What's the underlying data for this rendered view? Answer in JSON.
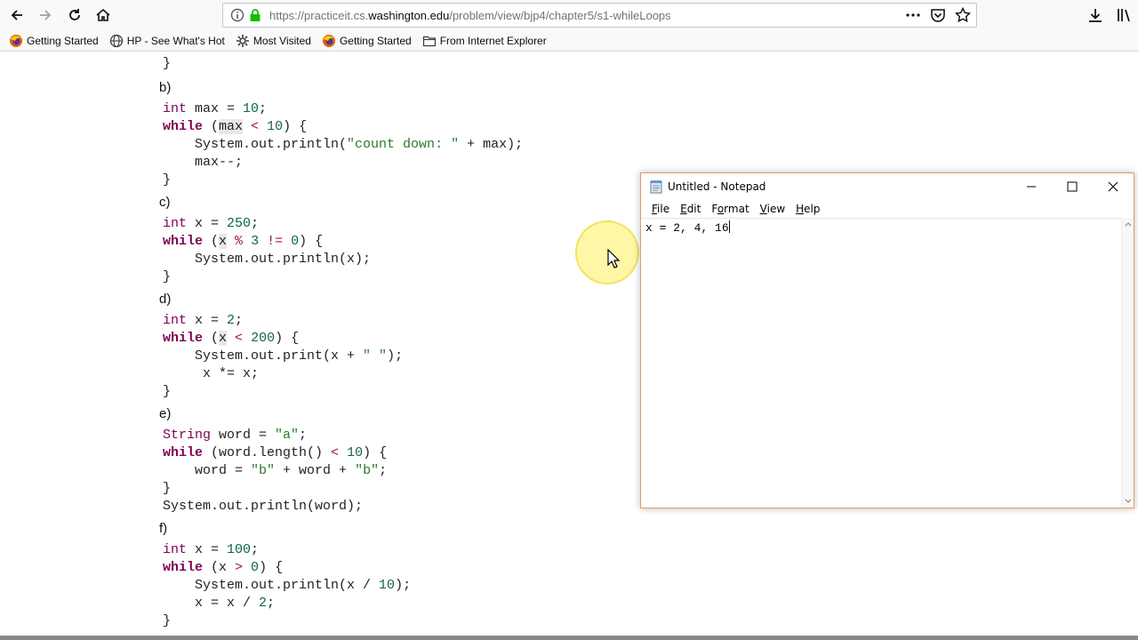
{
  "browser": {
    "url_prefix": "https://practiceit.cs.",
    "url_host": "washington.edu",
    "url_path": "/problem/view/bjp4/chapter5/s1-whileLoops",
    "bookmarks": [
      {
        "label": "Getting Started",
        "icon": "firefox-icon"
      },
      {
        "label": "HP - See What's Hot",
        "icon": "globe-icon"
      },
      {
        "label": "Most Visited",
        "icon": "gear-icon"
      },
      {
        "label": "Getting Started",
        "icon": "firefox-icon"
      },
      {
        "label": "From Internet Explorer",
        "icon": "folder-icon"
      }
    ]
  },
  "code": {
    "top_brace": "}",
    "b": {
      "label": "b)",
      "l1_type": "int",
      "l1_rest": " max = ",
      "l1_num": "10",
      "l1_end": ";",
      "l2_kw": "while",
      "l2_open": " (",
      "l2_var": "max",
      "l2_op": " < ",
      "l2_num": "10",
      "l2_end": ") {",
      "l3_a": "    System.out.println(",
      "l3_str": "\"count down: \"",
      "l3_b": " + max);",
      "l4": "    max--;",
      "l5": "}"
    },
    "c": {
      "label": "c)",
      "l1_type": "int",
      "l1_rest": " x = ",
      "l1_num": "250",
      "l1_end": ";",
      "l2_kw": "while",
      "l2_open": " (",
      "l2_var": "x",
      "l2_mid": " % ",
      "l2_num1": "3",
      "l2_op": " != ",
      "l2_num2": "0",
      "l2_end": ") {",
      "l3": "    System.out.println(x);",
      "l4": "}"
    },
    "d": {
      "label": "d)",
      "l1_type": "int",
      "l1_rest": " x = ",
      "l1_num": "2",
      "l1_end": ";",
      "l2_kw": "while",
      "l2_open": " (",
      "l2_var": "x",
      "l2_op": " < ",
      "l2_num": "200",
      "l2_end": ") {",
      "l3_a": "    System.out.print(x + ",
      "l3_str": "\" \"",
      "l3_b": ");",
      "l4": "     x *= x;",
      "l5": "}"
    },
    "e": {
      "label": "e)",
      "l1_type": "String",
      "l1_rest": " word = ",
      "l1_str": "\"a\"",
      "l1_end": ";",
      "l2_kw": "while",
      "l2_open": " (word.length()",
      "l2_op": " < ",
      "l2_num": "10",
      "l2_end": ") {",
      "l3_a": "    word = ",
      "l3_s1": "\"b\"",
      "l3_b": " + word + ",
      "l3_s2": "\"b\"",
      "l3_c": ";",
      "l4": "}",
      "l5": "System.out.println(word);"
    },
    "f": {
      "label": "f)",
      "l1_type": "int",
      "l1_rest": " x = ",
      "l1_num": "100",
      "l1_end": ";",
      "l2_kw": "while",
      "l2_open": " (x",
      "l2_op": " > ",
      "l2_num": "0",
      "l2_end": ") {",
      "l3_a": "    System.out.println(x / ",
      "l3_num": "10",
      "l3_b": ");",
      "l4_a": "    x = x / ",
      "l4_num": "2",
      "l4_b": ";",
      "l5": "}"
    }
  },
  "notepad": {
    "title": "Untitled - Notepad",
    "menus": [
      "File",
      "Edit",
      "Format",
      "View",
      "Help"
    ],
    "menu_accels": [
      "F",
      "E",
      "o",
      "V",
      "H"
    ],
    "text": "x = 2, 4, 16"
  },
  "colors": {
    "keyword": "#7f0055",
    "number": "#116644",
    "string": "#2a7a2a",
    "notepad_border": "#e39a62"
  }
}
